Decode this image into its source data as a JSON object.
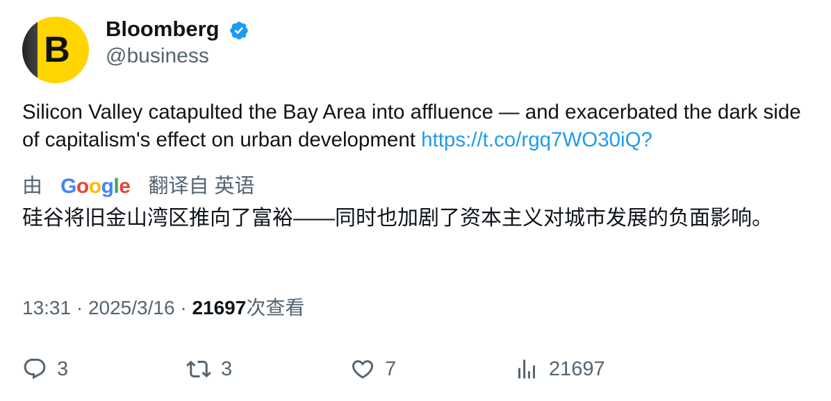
{
  "author": {
    "avatar_letter": "B",
    "name": "Bloomberg",
    "handle": "@business",
    "verified": true
  },
  "tweet": {
    "text": "Silicon Valley catapulted the Bay Area into affluence — and exacerbated the dark side of capitalism's effect on urban development ",
    "link": "https://t.co/rgq7WO30iQ?"
  },
  "translation": {
    "prefix": "由",
    "provider_letters": [
      "G",
      "o",
      "o",
      "g",
      "l",
      "e"
    ],
    "suffix": "翻译自 英语",
    "text": "硅谷将旧金山湾区推向了富裕——同时也加剧了资本主义对城市发展的负面影响。"
  },
  "meta": {
    "time": "13:31",
    "sep1": " · ",
    "date": "2025/3/16",
    "sep2": " · ",
    "views": "21697",
    "views_label": "次查看"
  },
  "actions": {
    "reply_count": "3",
    "retweet_count": "3",
    "like_count": "7",
    "views_count": "21697"
  },
  "colors": {
    "text": "#0f1419",
    "secondary": "#536471",
    "link": "#1d9bf0",
    "verified": "#1d9bf0",
    "avatar_bg": "#ffd400"
  },
  "icons": [
    "verified-badge-icon",
    "reply-icon",
    "retweet-icon",
    "like-icon",
    "views-icon"
  ]
}
